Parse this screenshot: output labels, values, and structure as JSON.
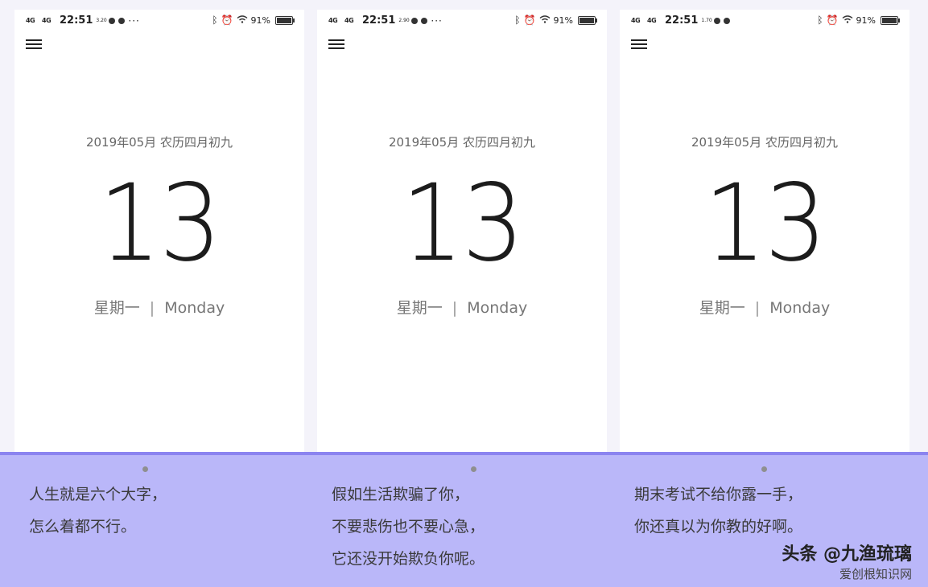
{
  "screens": [
    {
      "status": {
        "network": "4G",
        "network2": "4G",
        "time": "22:51",
        "speed": "3.20",
        "battery": "91%",
        "battery_fraction": 0.91
      },
      "date": {
        "year_month": "2019年05月",
        "lunar": "农历四月初九",
        "day": "13",
        "weekday_cn": "星期一",
        "weekday_en": "Monday"
      }
    },
    {
      "status": {
        "network": "4G",
        "network2": "4G",
        "time": "22:51",
        "speed": "2.90",
        "battery": "91%",
        "battery_fraction": 0.91
      },
      "date": {
        "year_month": "2019年05月",
        "lunar": "农历四月初九",
        "day": "13",
        "weekday_cn": "星期一",
        "weekday_en": "Monday"
      }
    },
    {
      "status": {
        "network": "4G",
        "network2": "4G",
        "time": "22:51",
        "speed": "1.70",
        "battery": "91%",
        "battery_fraction": 0.91
      },
      "date": {
        "year_month": "2019年05月",
        "lunar": "农历四月初九",
        "day": "13",
        "weekday_cn": "星期一",
        "weekday_en": "Monday"
      }
    }
  ],
  "captions": [
    {
      "lines": [
        "人生就是六个大字，",
        "怎么着都不行。"
      ]
    },
    {
      "lines": [
        "假如生活欺骗了你，",
        "不要悲伤也不要心急，",
        "它还没开始欺负你呢。"
      ]
    },
    {
      "lines": [
        "期末考试不给你露一手，",
        "你还真以为你教的好啊。"
      ]
    }
  ],
  "watermark": {
    "line1": "头条 @九渔琉璃",
    "line2": "爱创根知识网"
  },
  "colors": {
    "caption_band": "#bab7f9",
    "band_top_line": "#8b84f0",
    "screen_bg": "#ffffff"
  }
}
